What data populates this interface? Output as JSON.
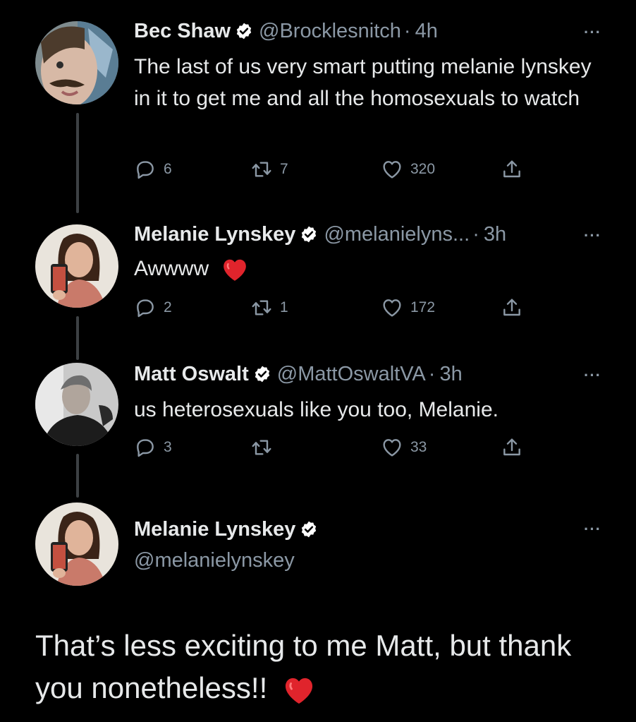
{
  "tweets": [
    {
      "name": "Bec Shaw",
      "handle": "@Brocklesnitch",
      "time": "4h",
      "text": "The last of us very smart putting melanie lynskey in it to get me and all the homosexuals to watch",
      "replies": "6",
      "retweets": "7",
      "likes": "320"
    },
    {
      "name": "Melanie Lynskey",
      "handle": "@melanielyns...",
      "time": "3h",
      "text": "Awwww",
      "replies": "2",
      "retweets": "1",
      "likes": "172"
    },
    {
      "name": "Matt Oswalt",
      "handle": "@MattOswaltVA",
      "time": "3h",
      "text": "us heterosexuals like you too, Melanie.",
      "replies": "3",
      "retweets": "",
      "likes": "33"
    }
  ],
  "main_tweet": {
    "name": "Melanie Lynskey",
    "handle": "@melanielynskey",
    "text": "That’s less exciting to me Matt, but thank you nonetheless!!"
  },
  "separator": "·",
  "more_glyph": "···",
  "colors": {
    "background": "#000000",
    "text": "#e7e9ea",
    "muted": "#8b98a5",
    "verified": "#ffffff",
    "heart": "#e0242c"
  },
  "icons": [
    "verified-badge-icon",
    "reply-icon",
    "retweet-icon",
    "like-icon",
    "share-icon",
    "more-icon",
    "red-heart-emoji"
  ]
}
